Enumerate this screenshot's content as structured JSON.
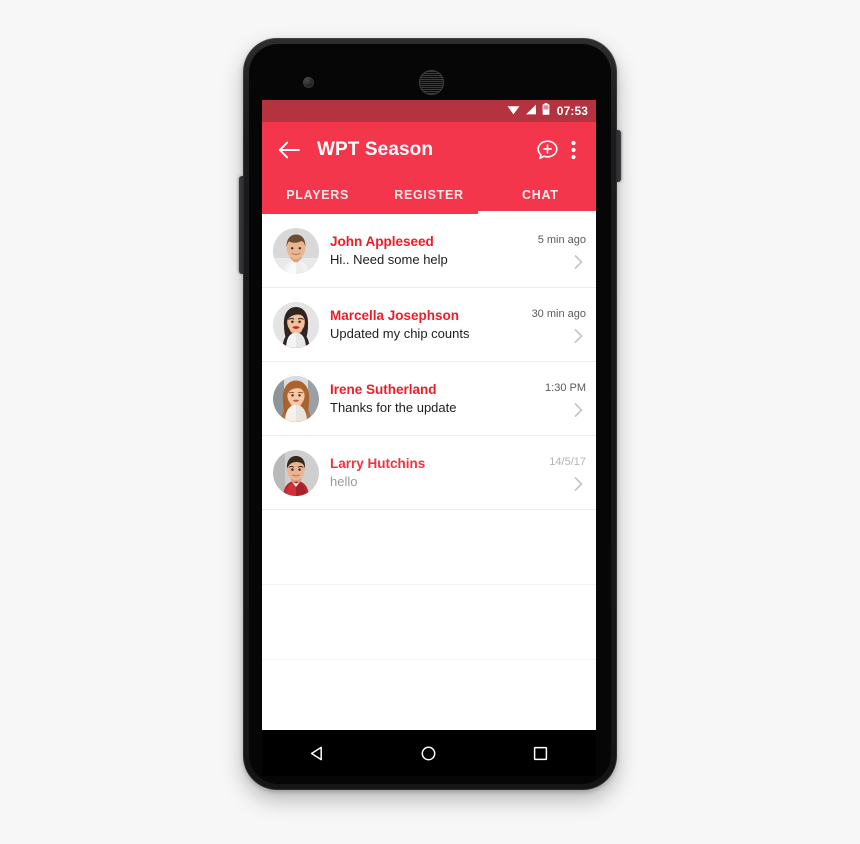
{
  "device": {
    "front_camera_icon": "front-camera-icon",
    "earpiece_icon": "earpiece-speaker-icon",
    "volume_rocker_label": "Volume",
    "power_button_label": "Power"
  },
  "status_bar": {
    "wifi_icon": "wifi-icon",
    "signal_icon": "cellular-signal-icon",
    "battery_icon": "battery-icon",
    "time": "07:53"
  },
  "app_bar": {
    "back_icon": "arrow-left-icon",
    "title": "WPT Season",
    "new_chat_icon": "new-chat-bubble-plus-icon",
    "overflow_icon": "overflow-menu-icon"
  },
  "tabs": {
    "items": [
      {
        "label": "PLAYERS",
        "active": false
      },
      {
        "label": "REGISTER",
        "active": false
      },
      {
        "label": "CHAT",
        "active": true
      }
    ],
    "active_index": 2
  },
  "chat_list": {
    "rows": [
      {
        "name": "John Appleseed",
        "preview": "Hi.. Need some help",
        "time": "5 min ago",
        "read": false,
        "avatar": "avatar-john-appleseed",
        "chevron_icon": "chevron-right-icon"
      },
      {
        "name": "Marcella Josephson",
        "preview": "Updated my chip counts",
        "time": "30 min ago",
        "read": false,
        "avatar": "avatar-marcella-josephson",
        "chevron_icon": "chevron-right-icon"
      },
      {
        "name": "Irene Sutherland",
        "preview": "Thanks for the update",
        "time": "1:30 PM",
        "read": false,
        "avatar": "avatar-irene-sutherland",
        "chevron_icon": "chevron-right-icon"
      },
      {
        "name": "Larry Hutchins",
        "preview": "hello",
        "time": "14/5/17",
        "read": true,
        "avatar": "avatar-larry-hutchins",
        "chevron_icon": "chevron-right-icon"
      }
    ],
    "empty_row_count": 3
  },
  "nav_bar": {
    "back_icon": "nav-back-triangle-icon",
    "home_icon": "nav-home-circle-icon",
    "recents_icon": "nav-recents-square-icon"
  },
  "colors": {
    "status_bar": "#b5333f",
    "app_bar": "#f4364c",
    "accent_name": "#ee1c25",
    "preview_text": "#1d1d1d",
    "muted_text": "#9b9b9b",
    "page_background": "#f7f7f7"
  }
}
